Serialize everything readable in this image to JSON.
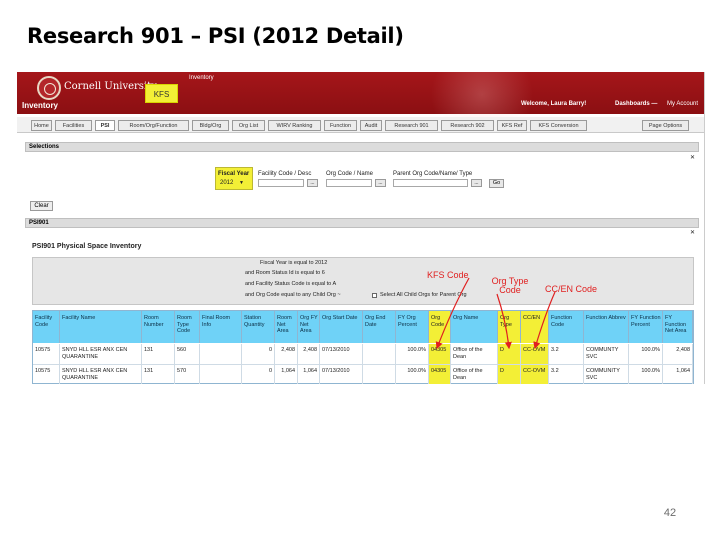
{
  "slide": {
    "title": "Research 901 – PSI (2012 Detail)",
    "page_number": "42"
  },
  "header": {
    "university": "Cornell University",
    "app_name": "Inventory",
    "small_label": "Inventory",
    "badge": "KFS",
    "welcome": "Welcome, Laura Barry!",
    "dashboards": "Dashboards —",
    "my_account": "My Account",
    "brand_color": "#a5161a",
    "accent_color": "#f3ef36"
  },
  "tabs": [
    "Home",
    "Facilities",
    "PSI",
    "Room/Org/Function",
    "Bldg/Org",
    "Org List",
    "WIRV Ranking",
    "Function",
    "Audit",
    "Research 901",
    "Research 902",
    "KFS Ref",
    "KFS Conversion"
  ],
  "active_tab": "PSI",
  "page_options": "Page Options",
  "selections": {
    "title": "Selections",
    "toggle": "✕",
    "fiscal_year_label": "Fiscal Year",
    "fiscal_year_value": "2012",
    "facility_label": "Facility Code / Desc",
    "org_label": "Org Code / Name",
    "parent_org_label": "Parent Org Code/Name/ Type",
    "lookup": "...",
    "go": "Go",
    "clear": "Clear"
  },
  "report": {
    "section": "PSI901",
    "toggle": "✕",
    "title": "PSI901 Physical Space Inventory",
    "filters": [
      "Fiscal Year is equal to 2012",
      "and Room Status Id is equal to 6",
      "and Facility Status Code is equal to A",
      "and Org Code equal to any Child Org ~"
    ],
    "checkbox_label": "Select All Child Orgs for Parent Org"
  },
  "annotations": {
    "kfs_code": "KFS Code",
    "org_type_code": "Org Type Code",
    "cc_en_code": "CC/EN Code"
  },
  "table": {
    "headers": [
      "Facility Code",
      "Facility Name",
      "Room Number",
      "Room Type Code",
      "Final Room Info",
      "Station Quantity",
      "Room Net Area",
      "Org FY Net Area",
      "Org Start Date",
      "Org End Date",
      "FY Org Percent",
      "Org Code",
      "Org Name",
      "Org Type",
      "CC/EN",
      "Function Code",
      "Function Abbrev",
      "FY Function Percent",
      "FY Function Net Area"
    ],
    "rows": [
      [
        "10575",
        "SNYD HLL ESR ANX CEN QUARANTINE",
        "131",
        "560",
        "",
        "0",
        "2,408",
        "2,408",
        "07/13/2010",
        "",
        "100.0%",
        "04305",
        "Office of the Dean",
        "D",
        "CC-OVM",
        "3.2",
        "COMMUNTY SVC",
        "100.0%",
        "2,408"
      ],
      [
        "10575",
        "SNYD HLL ESR ANX CEN QUARANTINE",
        "131",
        "570",
        "",
        "0",
        "1,064",
        "1,064",
        "07/13/2010",
        "",
        "100.0%",
        "04305",
        "Office of the Dean",
        "D",
        "CC-OVM",
        "3.2",
        "COMMUNITY SVC",
        "100.0%",
        "1,064"
      ]
    ]
  }
}
